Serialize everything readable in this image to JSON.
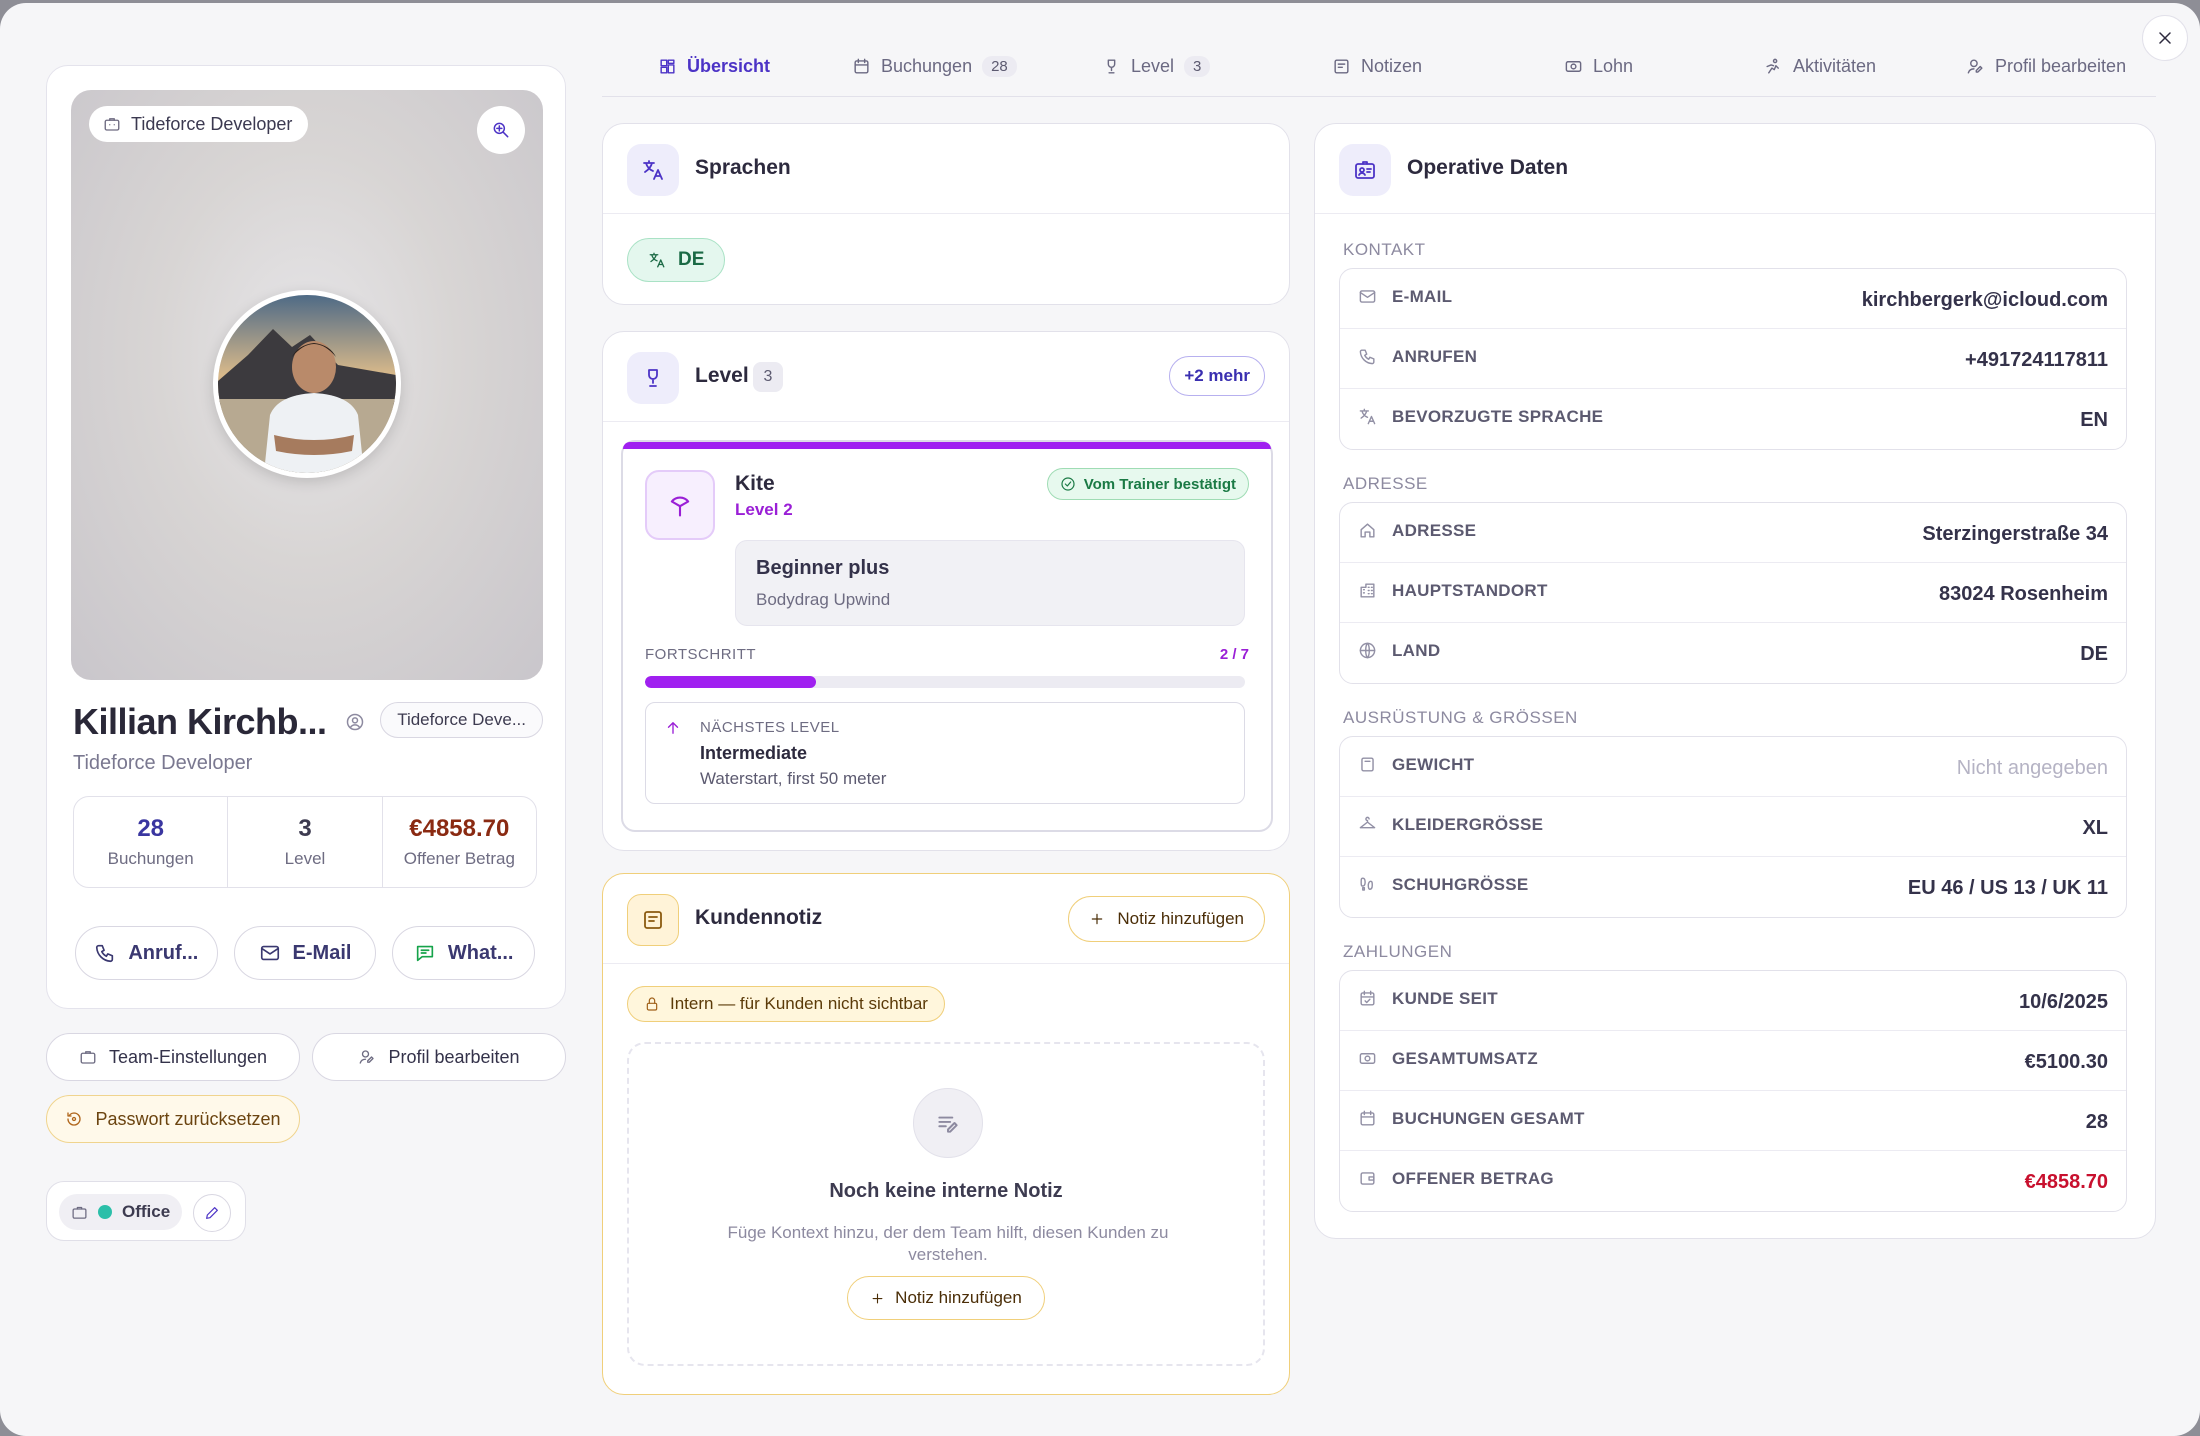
{
  "close_label": "×",
  "profile": {
    "cover_tag": "Tideforce Developer",
    "name": "Killian Kirchb...",
    "name_badge": "Tideforce Deve...",
    "role": "Tideforce Developer",
    "stats": [
      {
        "value": "28",
        "label": "Buchungen"
      },
      {
        "value": "3",
        "label": "Level"
      },
      {
        "value": "€4858.70",
        "label": "Offener Betrag"
      }
    ],
    "contact_buttons": {
      "call": "Anruf...",
      "email": "E-Mail",
      "whatsapp": "What..."
    },
    "team_settings": "Team-Einstellungen",
    "edit_profile": "Profil bearbeiten",
    "reset_password": "Passwort zurücksetzen",
    "office": "Office"
  },
  "tabs": [
    {
      "label": "Übersicht",
      "icon": "grid-icon"
    },
    {
      "label": "Buchungen",
      "count": "28",
      "icon": "calendar-icon"
    },
    {
      "label": "Level",
      "count": "3",
      "icon": "trophy-icon"
    },
    {
      "label": "Notizen",
      "icon": "note-icon"
    },
    {
      "label": "Lohn",
      "icon": "money-icon"
    },
    {
      "label": "Aktivitäten",
      "icon": "activity-icon"
    },
    {
      "label": "Profil bearbeiten",
      "icon": "user-edit-icon"
    }
  ],
  "languages": {
    "title": "Sprachen",
    "items": [
      "DE"
    ]
  },
  "level": {
    "title": "Level",
    "count": "3",
    "more": "+2 mehr",
    "skill": {
      "name": "Kite",
      "level": "Level 2",
      "badge": "Vom Trainer bestätigt",
      "box_title": "Beginner plus",
      "box_sub": "Bodydrag Upwind",
      "progress_label": "FORTSCHRITT",
      "progress_text": "2 / 7",
      "progress_fraction": 0.2857,
      "next_label": "NÄCHSTES LEVEL",
      "next_title": "Intermediate",
      "next_sub": "Waterstart, first 50 meter"
    }
  },
  "note": {
    "title": "Kundennotiz",
    "add_label": "Notiz hinzufügen",
    "intern_badge": "Intern — für Kunden nicht sichtbar",
    "empty_title": "Noch keine interne Notiz",
    "empty_sub": "Füge Kontext hinzu, der dem Team hilft, diesen Kunden zu verstehen.",
    "empty_button": "Notiz hinzufügen"
  },
  "operative": {
    "title": "Operative Daten",
    "groups": [
      {
        "title": "KONTAKT",
        "rows": [
          {
            "icon": "mail-icon",
            "label": "E-MAIL",
            "value": "kirchbergerk@icloud.com"
          },
          {
            "icon": "phone-icon",
            "label": "ANRUFEN",
            "value": "+491724117811"
          },
          {
            "icon": "translate-icon",
            "label": "BEVORZUGTE SPRACHE",
            "value": "EN"
          }
        ]
      },
      {
        "title": "ADRESSE",
        "rows": [
          {
            "icon": "home-icon",
            "label": "ADRESSE",
            "value": "Sterzingerstraße 34"
          },
          {
            "icon": "building-icon",
            "label": "HAUPTSTANDORT",
            "value": "83024 Rosenheim"
          },
          {
            "icon": "globe-icon",
            "label": "LAND",
            "value": "DE"
          }
        ]
      },
      {
        "title": "AUSRÜSTUNG & GRÖSSEN",
        "rows": [
          {
            "icon": "scale-icon",
            "label": "GEWICHT",
            "value": "Nicht angegeben"
          },
          {
            "icon": "hanger-icon",
            "label": "KLEIDERGRÖSSE",
            "value": "XL"
          },
          {
            "icon": "footprint-icon",
            "label": "SCHUHGRÖSSE",
            "value": "EU 46 / US 13 / UK 11"
          }
        ]
      },
      {
        "title": "ZAHLUNGEN",
        "rows": [
          {
            "icon": "calendar-check-icon",
            "label": "KUNDE SEIT",
            "value": "10/6/2025"
          },
          {
            "icon": "cash-icon",
            "label": "GESAMTUMSATZ",
            "value": "€5100.30"
          },
          {
            "icon": "calendar-icon",
            "label": "BUCHUNGEN GESAMT",
            "value": "28"
          },
          {
            "icon": "wallet-icon",
            "label": "OFFENER BETRAG",
            "value": "€4858.70"
          }
        ]
      }
    ]
  },
  "colors": {
    "accent": "#4c33c6",
    "level_purple": "#a020f0",
    "note_border": "#f0cf7a",
    "danger": "#c8102e",
    "online_dot": "#2bbfa9"
  }
}
